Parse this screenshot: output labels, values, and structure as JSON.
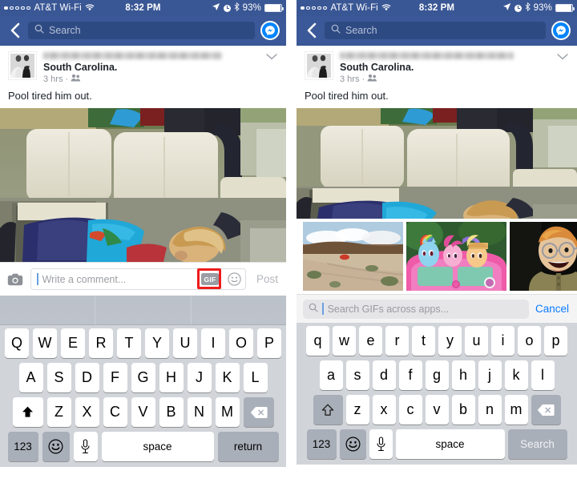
{
  "meta": {
    "app": "Facebook iOS",
    "screens": [
      "comment-composer-with-gif-button",
      "gif-picker-open"
    ]
  },
  "colors": {
    "facebook_blue": "#3b5998",
    "status_bar_blue": "#3a5795",
    "search_field_blue": "#2e4a82",
    "highlight_red": "#ef1b1b",
    "link_blue": "#0a7cff",
    "keyboard_bg": "#d1d4d9",
    "key_white": "#ffffff",
    "key_gray": "#a9afb9",
    "placeholder_gray": "#9b9ea3"
  },
  "status_bar": {
    "signal_dots": 5,
    "signal_filled": 1,
    "carrier": "AT&T Wi-Fi",
    "wifi_icon": "wifi-icon",
    "time": "8:32 PM",
    "location_icon": "location-arrow-icon",
    "alarm_icon": "alarm-clock-icon",
    "bluetooth_icon": "bluetooth-icon",
    "battery_percent": "93%",
    "battery_level": 93
  },
  "navbar": {
    "back_icon": "back-chevron-icon",
    "search_icon": "search-icon",
    "search_placeholder": "Search",
    "search_value": "",
    "messenger_icon": "messenger-icon"
  },
  "post": {
    "avatar_icon": "profile-avatar-image",
    "author_name_blurred": true,
    "location": "South Carolina.",
    "timestamp": "3 hrs",
    "separator": "·",
    "audience_icon": "friends-audience-icon",
    "more_icon": "chevron-down-icon",
    "body_text": "Pool tired him out.",
    "photo_alt": "boy asleep across golf cart seats"
  },
  "left_screen": {
    "comment_bar": {
      "camera_icon": "camera-icon",
      "placeholder": "Write a comment...",
      "value": "",
      "caret_visible": true,
      "gif_button_label": "GIF",
      "gif_button_highlighted": true,
      "sticker_icon": "smiley-face-icon",
      "post_label": "Post",
      "post_enabled": false
    }
  },
  "right_screen": {
    "gif_tray": {
      "items": [
        {
          "name": "gif-thumbnail-desert-road",
          "alt": "red car on dusty desert road"
        },
        {
          "name": "gif-thumbnail-my-little-pony",
          "alt": "My Little Pony characters riding in pink cart"
        },
        {
          "name": "gif-thumbnail-cartoon-man",
          "alt": "laughing cartoon man with glasses"
        }
      ]
    },
    "gif_search": {
      "search_icon": "search-icon",
      "placeholder": "Search GIFs across apps...",
      "value": "",
      "caret_visible": true,
      "cancel_label": "Cancel"
    }
  },
  "keyboard_left": {
    "case": "uppercase",
    "predictive_cells": [
      "",
      "",
      ""
    ],
    "rows": [
      [
        "Q",
        "W",
        "E",
        "R",
        "T",
        "Y",
        "U",
        "I",
        "O",
        "P"
      ],
      [
        "A",
        "S",
        "D",
        "F",
        "G",
        "H",
        "J",
        "K",
        "L"
      ],
      [
        "Z",
        "X",
        "C",
        "V",
        "B",
        "N",
        "M"
      ]
    ],
    "shift_icon": "shift-filled-icon",
    "delete_icon": "backspace-icon",
    "numbers_label": "123",
    "emoji_icon": "emoji-smiley-icon",
    "dictation_icon": "microphone-icon",
    "space_label": "space",
    "action_label": "return",
    "action_enabled": true
  },
  "keyboard_right": {
    "case": "lowercase",
    "rows": [
      [
        "q",
        "w",
        "e",
        "r",
        "t",
        "y",
        "u",
        "i",
        "o",
        "p"
      ],
      [
        "a",
        "s",
        "d",
        "f",
        "g",
        "h",
        "j",
        "k",
        "l"
      ],
      [
        "z",
        "x",
        "c",
        "v",
        "b",
        "n",
        "m"
      ]
    ],
    "shift_icon": "shift-outline-icon",
    "delete_icon": "backspace-icon",
    "numbers_label": "123",
    "emoji_icon": "emoji-smiley-icon",
    "dictation_icon": "microphone-icon",
    "space_label": "space",
    "action_label": "Search",
    "action_enabled": false
  }
}
